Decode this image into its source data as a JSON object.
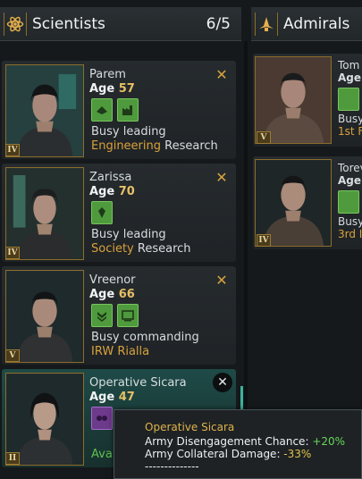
{
  "scientists_header": {
    "title": "Scientists",
    "count": "6/5"
  },
  "admirals_header": {
    "title": "Admirals"
  },
  "scientists": [
    {
      "name": "Parem",
      "age_label": "Age",
      "age": "57",
      "rank": "IV",
      "status": "Busy leading",
      "detail_highlight": "Engineering",
      "detail_rest": " Research"
    },
    {
      "name": "Zarissa",
      "age_label": "Age",
      "age": "70",
      "rank": "IV",
      "status": "Busy leading",
      "detail_highlight": "Society",
      "detail_rest": " Research"
    },
    {
      "name": "Vreenor",
      "age_label": "Age",
      "age": "66",
      "rank": "V",
      "status": "Busy commanding",
      "detail_highlight": "IRW Rialla",
      "detail_rest": ""
    },
    {
      "name": "Operative Sicara",
      "age_label": "Age",
      "age": "47",
      "rank": "II",
      "status_partial": "Ava"
    }
  ],
  "admirals": [
    {
      "name": "Tom",
      "age_label": "Age",
      "rank": "V",
      "status": "Busy",
      "detail": "1st F"
    },
    {
      "name": "Torev",
      "age_label": "Age",
      "rank": "IV",
      "status": "Busy",
      "detail": "3rd I"
    }
  ],
  "tooltip": {
    "title": "Operative Sicara",
    "line1_label": "Army Disengagement Chance: ",
    "line1_value": "+20%",
    "line2_label": "Army Collateral Damage: ",
    "line2_value": "-33%",
    "separator": "--------------"
  },
  "colors": {
    "gold": "#d8a23c",
    "trait_green": "#4e9a3d",
    "trait_purple": "#6e3a8c",
    "active_teal": "#1e4a47"
  },
  "icons": {
    "scientists": "atom-icon",
    "admirals": "starship-icon",
    "close": "x-icon"
  }
}
